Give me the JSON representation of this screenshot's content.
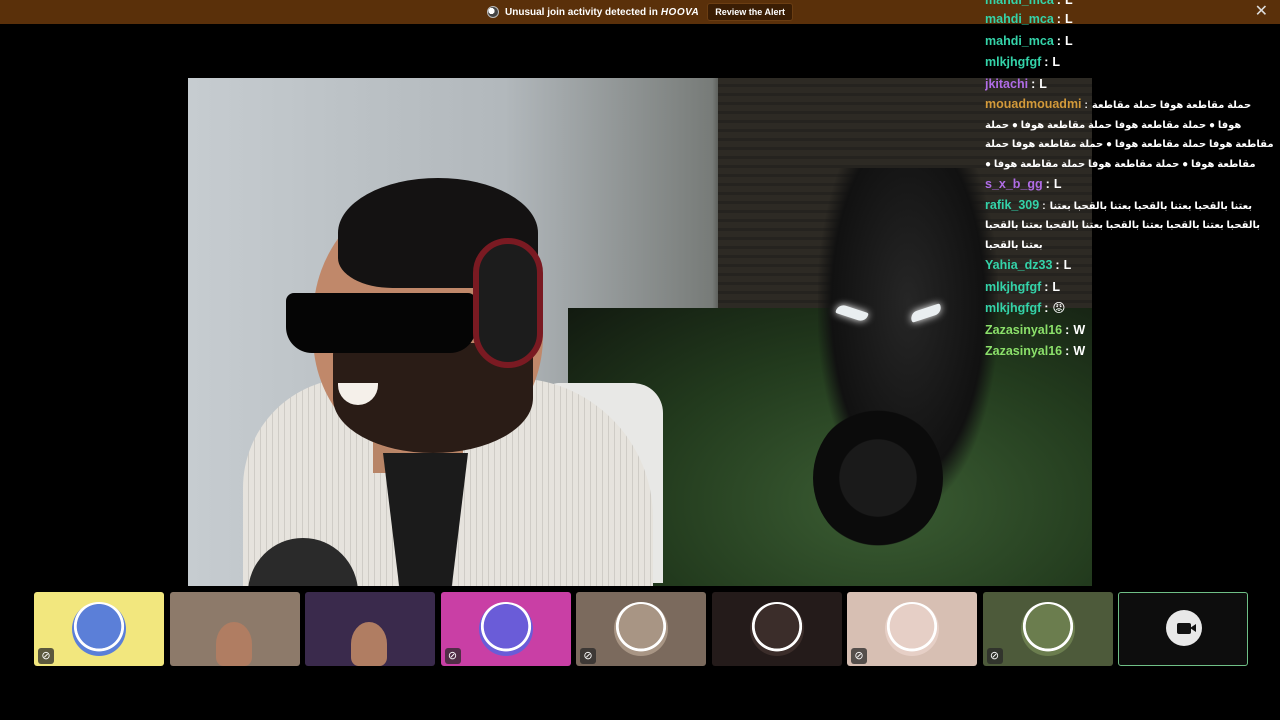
{
  "alert": {
    "message": "Unusual join activity detected in",
    "brand": "HOOVA",
    "button_label": "Review the Alert",
    "close_symbol": "✕"
  },
  "chat": {
    "messages": [
      {
        "user": "mahdi_mca",
        "text": "L",
        "color": "#34d3a9",
        "cut": true
      },
      {
        "user": "mahdi_mca",
        "text": "L",
        "color": "#34d3a9"
      },
      {
        "user": "mahdi_mca",
        "text": "L",
        "color": "#34d3a9"
      },
      {
        "user": "mlkjhgfgf",
        "text": "L",
        "color": "#34d3a9"
      },
      {
        "user": "jkitachi",
        "text": "L",
        "color": "#b06ce6"
      },
      {
        "user": "mouadmouadmi",
        "text": "حملة مقاطعة هوفا حملة مقاطعة هوفا ● حملة مقاطعة هوفا حملة مقاطعة هوفا ● حملة مقاطعة هوفا حملة مقاطعة هوفا ● حملة مقاطعة هوفا حملة مقاطعة هوفا ● حملة مقاطعة هوفا حملة مقاطعة هوفا ●",
        "color": "#d39a3a",
        "long": true
      },
      {
        "user": "s_x_b_gg",
        "text": "L",
        "color": "#b06ce6"
      },
      {
        "user": "rafik_309",
        "text": "بعتنا بالقحبا بعتنا بالقحبا بعتنا بالقحبا بعتنا بالقحبا بعتنا بالقحبا بعتنا بالقحبا بعتنا بالقحبا بعتنا بالقحبا بعتنا بالقحبا",
        "color": "#34d3a9",
        "long": true
      },
      {
        "user": "Yahia_dz33",
        "text": "L",
        "color": "#34d3a9"
      },
      {
        "user": "mlkjhgfgf",
        "text": "L",
        "color": "#34d3a9"
      },
      {
        "user": "mlkjhgfgf",
        "text": "😡",
        "color": "#34d3a9"
      },
      {
        "user": "Zazasinyal16",
        "text": "W",
        "color": "#8be06a"
      },
      {
        "user": "Zazasinyal16",
        "text": "W",
        "color": "#8be06a"
      }
    ]
  },
  "participants": [
    {
      "kind": "avatar",
      "bg": "#f2e77e",
      "avatar_color": "#5b7fd8",
      "muted": true
    },
    {
      "kind": "video",
      "bg": "#8d7a6a",
      "muted": false
    },
    {
      "kind": "video",
      "bg": "#3a2a4c",
      "muted": false
    },
    {
      "kind": "avatar",
      "bg": "#c93fa5",
      "avatar_color": "#6a5cd8",
      "muted": true
    },
    {
      "kind": "avatar",
      "bg": "#7b6a5d",
      "avatar_color": "#a89584",
      "muted": true
    },
    {
      "kind": "avatar",
      "bg": "#241b1a",
      "avatar_color": "#3b2d2a",
      "muted": false
    },
    {
      "kind": "avatar",
      "bg": "#d7bfb3",
      "avatar_color": "#e6cfc6",
      "muted": true
    },
    {
      "kind": "avatar",
      "bg": "#4d5a3a",
      "avatar_color": "#6b7d4e",
      "muted": true
    },
    {
      "kind": "camera",
      "bg": "#0d0d0d",
      "muted": false
    }
  ],
  "icons": {
    "muted": "🔇",
    "camera": "camera-icon"
  }
}
